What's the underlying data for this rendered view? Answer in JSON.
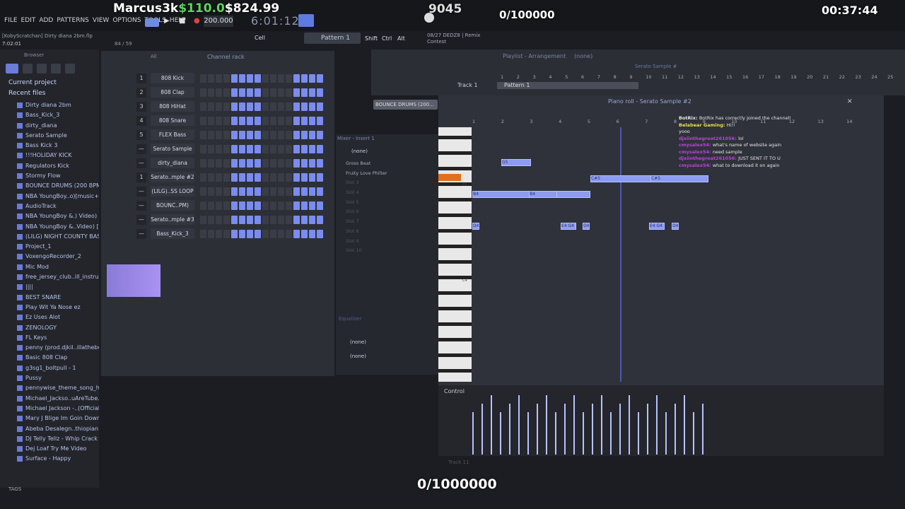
{
  "stream_overlay": {
    "streamer": "Marcus3k",
    "money_green": "$110.0",
    "money_white": "$824.99",
    "counter": "9045",
    "goal": "0/100000",
    "timer": "00:37:44",
    "bottom_goal": "0/1000000"
  },
  "menu": [
    "FILE",
    "EDIT",
    "ADD",
    "PATTERNS",
    "VIEW",
    "OPTIONS",
    "TOOLS",
    "HELP"
  ],
  "project_title": "[KobyScratchan] Dirty diana 2bm.flp",
  "time_small": "7:02:01",
  "transport": {
    "tempo": "200.000",
    "song_time": "6:01:12",
    "pattern": "Pattern 1",
    "mode": "Cell",
    "track_info": "84 / 59"
  },
  "hint_panel": {
    "line1": "08/27  DEDZ8 | Remix",
    "line2": "Contest"
  },
  "toolbar_labels": {
    "shift": "Shift",
    "ctrl": "Ctrl",
    "alt": "Alt"
  },
  "browser": {
    "title": "Browser",
    "tabs": [
      "All"
    ],
    "folders": {
      "current": "Current project",
      "recent": "Recent files"
    },
    "items": [
      "Dirty diana 2bm",
      "Bass_Kick_3",
      "dirty_diana",
      "Serato Sample",
      "Bass Kick 3",
      "!!!HOLIDAY KICK",
      "Regulators Kick",
      "Stormy Flow",
      "BOUNCE DRUMS (200 BPM)",
      "NBA YoungBoy..o)[music+vocals]",
      "AudioTrack",
      "NBA YoungBoy &.) Video) [music]",
      "NBA YoungBoy &..Video) [vocals]",
      "(LILG) NIGHT COUNTY BASS LOOP",
      "Project_1",
      "VoxengoRecorder_2",
      "Mic Mod",
      "free_jersey_club..ill_instrumental",
      "||||",
      "BEST SNARE",
      "Play Wit Ya Nose ez",
      "Ez Uses Alot",
      "ZENOLOGY",
      "FL Keys",
      "penny (prod.djkil..illathebeatplug",
      "Basic 808 Clap",
      "g3sg1_boltpull - 1",
      "Pussy",
      "pennywise_theme_song_hq",
      "Michael_Jackso..uAreTube.com_)",
      "Michael Jackson -..(Official Audio)",
      "Mary J Blige  Im Goin Down",
      "Abeba Desalegn..thiopian Music",
      "DJ Telly Tellz - Whip Crack Loop",
      "Dej Loaf  Try Me Video",
      "Surface - Happy"
    ],
    "footer": "TAGS"
  },
  "channel_rack": {
    "title": "Channel rack",
    "filter": "All",
    "rows": [
      {
        "num": "1",
        "name": "808 Kick"
      },
      {
        "num": "2",
        "name": "808 Clap"
      },
      {
        "num": "3",
        "name": "808 HiHat"
      },
      {
        "num": "4",
        "name": "808 Snare"
      },
      {
        "num": "5",
        "name": "FLEX Bass"
      },
      {
        "num": "—",
        "name": "Serato Sample"
      },
      {
        "num": "—",
        "name": "dirty_diana"
      },
      {
        "num": "1",
        "name": "Serato..mple #2"
      },
      {
        "num": "—",
        "name": "(LILG)..SS LOOP"
      },
      {
        "num": "—",
        "name": "BOUNC..PM)"
      },
      {
        "num": "—",
        "name": "Serato..mple #3"
      },
      {
        "num": "—",
        "name": "Bass_Kick_3"
      }
    ]
  },
  "playlist": {
    "title": "Playlist - Arrangement",
    "selector": "(none)",
    "track": "Track 1",
    "pattern_clip": "Pattern 1",
    "sample_tab": "Serato Sample #",
    "ruler": [
      "1",
      "2",
      "3",
      "4",
      "5",
      "6",
      "7",
      "8",
      "9",
      "10",
      "11",
      "12",
      "13",
      "14",
      "15",
      "16",
      "17",
      "18",
      "19",
      "20",
      "21",
      "22",
      "23",
      "24",
      "25"
    ]
  },
  "mixer": {
    "title": "Mixer - Insert 1",
    "preset": "(none)",
    "slots": [
      "Gross Beat",
      "Fruity Love Philter",
      "Slot 3",
      "Slot 4",
      "Slot 5",
      "Slot 6",
      "Slot 7",
      "Slot 8",
      "Slot 9",
      "Slot 10"
    ],
    "eq": "Equalizer",
    "bottom1": "(none)",
    "bottom2": "(none)"
  },
  "pattern_clips": {
    "clip1": "dirty_diana",
    "clip2": "BOUNCE DRUMS (200..."
  },
  "piano_roll": {
    "title": "Piano roll - Serato Sample #2",
    "ruler": [
      "1",
      "2",
      "3",
      "4",
      "5",
      "6",
      "7",
      "8",
      "9",
      "10",
      "11",
      "12",
      "13",
      "14"
    ],
    "control_label": "Control",
    "track_label": "Track 11",
    "key_labels": {
      "c5": "C5",
      "c4": "C4"
    }
  },
  "notes": [
    {
      "label": "G5"
    },
    {
      "label": "C#5"
    },
    {
      "label": "C#5"
    },
    {
      "label": "B4"
    },
    {
      "label": "B4"
    },
    {
      "label": "D4"
    },
    {
      "label": "E4 G4"
    },
    {
      "label": "D4"
    },
    {
      "label": "E4 G4"
    },
    {
      "label": "D4"
    }
  ],
  "chat": [
    {
      "user": "BotRix",
      "color": "#e6e6e6",
      "text": "BotRix has correctly joined the channel!"
    },
    {
      "user": "Belabear Gaming",
      "color": "#e8e24a",
      "text": "Hi!!"
    },
    {
      "user": "",
      "color": "#7a5cff",
      "text": "yooo"
    },
    {
      "user": "djxiinthegreat261056",
      "color": "#c03fe0",
      "text": "lol"
    },
    {
      "user": "cmysalex54",
      "color": "#c03fe0",
      "text": "what's name of website again"
    },
    {
      "user": "cmysalex54",
      "color": "#c03fe0",
      "text": "need sample"
    },
    {
      "user": "djxiinthegreat261056",
      "color": "#c03fe0",
      "text": "JUST SENT IT TO U"
    },
    {
      "user": "cmysalex54",
      "color": "#c03fe0",
      "text": "what to download it on again"
    }
  ]
}
